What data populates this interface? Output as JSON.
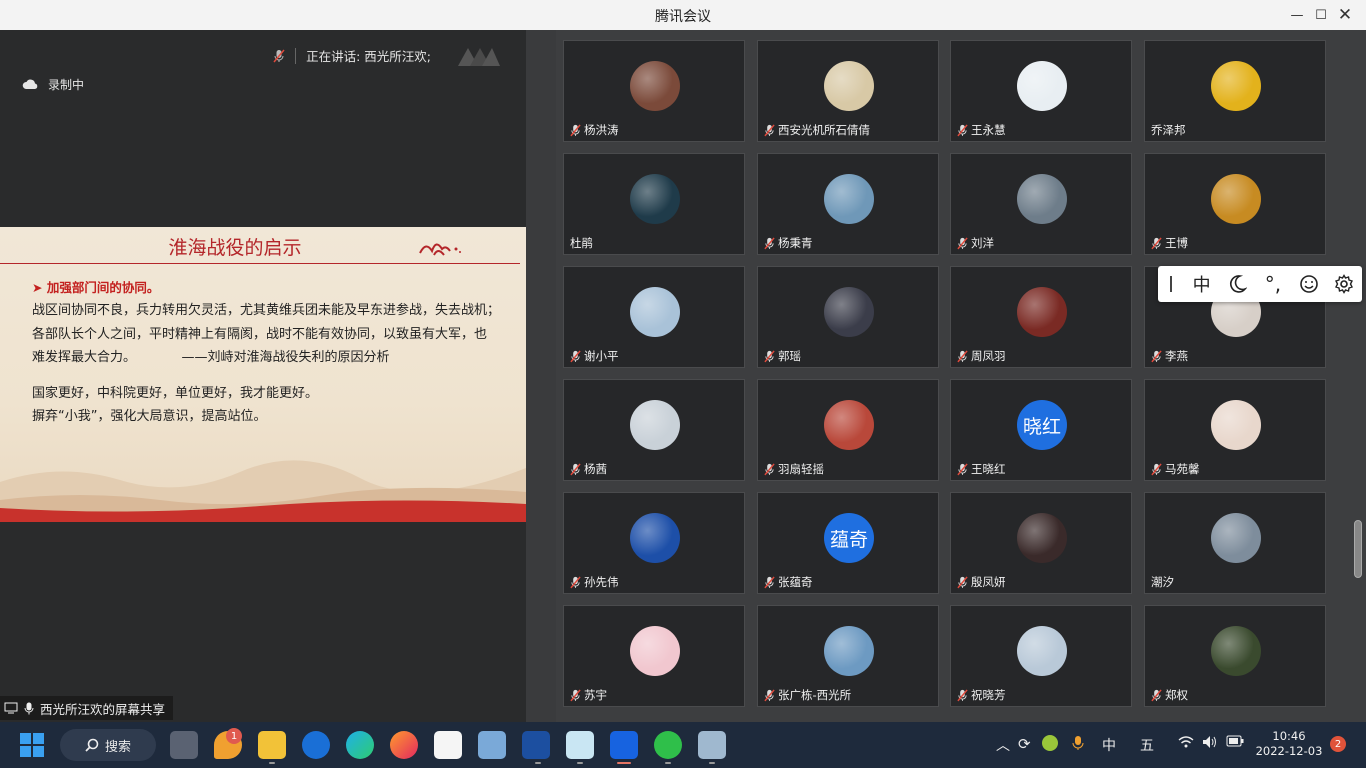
{
  "window": {
    "title": "腾讯会议"
  },
  "meeting": {
    "speaking": "正在讲话: 西光所汪欢;",
    "recording": "录制中",
    "share_label": "西光所汪欢的屏幕共享"
  },
  "slide": {
    "title": "淮海战役的启示",
    "subtitle": "➤ 加强部门间的协同。",
    "lines": [
      "战区间协同不良，兵力转用欠灵活，尤其黄维兵团未能及早东进参战，失去战机；",
      "各部队长个人之间，平时精神上有隔阂，战时不能有效协同，以致虽有大军，也",
      "难发挥最大合力。　　　　——刘峙对淮海战役失利的原因分析"
    ],
    "lines2": [
      "国家更好，中科院更好，单位更好，我才能更好。",
      "摒弃“小我”，强化大局意识，提高站位。"
    ]
  },
  "participants": [
    {
      "name": "杨洪涛",
      "muted": true,
      "avatar_text": "",
      "color": "#7b4a3a"
    },
    {
      "name": "西安光机所石倩倩",
      "muted": true,
      "avatar_text": "",
      "color": "#d8c9a6"
    },
    {
      "name": "王永慧",
      "muted": true,
      "avatar_text": "",
      "color": "#e8eef2"
    },
    {
      "name": "乔泽邦",
      "muted": false,
      "avatar_text": "",
      "color": "#e3b21c"
    },
    {
      "name": "杜鹃",
      "muted": false,
      "avatar_text": "",
      "color": "#1f3b4a"
    },
    {
      "name": "杨秉青",
      "muted": true,
      "avatar_text": "",
      "color": "#6f98b8"
    },
    {
      "name": "刘洋",
      "muted": true,
      "avatar_text": "",
      "color": "#6e7d8a"
    },
    {
      "name": "王博",
      "muted": true,
      "avatar_text": "",
      "color": "#c78b22"
    },
    {
      "name": "谢小平",
      "muted": true,
      "avatar_text": "",
      "color": "#a9c2d8"
    },
    {
      "name": "郭瑶",
      "muted": true,
      "avatar_text": "",
      "color": "#3b3d4a"
    },
    {
      "name": "周凤羽",
      "muted": true,
      "avatar_text": "",
      "color": "#7a2a24"
    },
    {
      "name": "李燕",
      "muted": true,
      "avatar_text": "",
      "color": "#d7cfc8"
    },
    {
      "name": "杨茜",
      "muted": true,
      "avatar_text": "",
      "color": "#c9d1d8"
    },
    {
      "name": "羽扇轻摇",
      "muted": true,
      "avatar_text": "",
      "color": "#b9483a"
    },
    {
      "name": "王晓红",
      "muted": true,
      "avatar_text": "晓红",
      "color": "#1f6fe0"
    },
    {
      "name": "马苑馨",
      "muted": true,
      "avatar_text": "",
      "color": "#e8d7cc"
    },
    {
      "name": "孙先伟",
      "muted": true,
      "avatar_text": "",
      "color": "#1d4fa8"
    },
    {
      "name": "张蕴奇",
      "muted": true,
      "avatar_text": "蕴奇",
      "color": "#1f6fe0"
    },
    {
      "name": "殷凤妍",
      "muted": true,
      "avatar_text": "",
      "color": "#3a2a2a"
    },
    {
      "name": "潮汐",
      "muted": false,
      "avatar_text": "",
      "color": "#7e8d9c"
    },
    {
      "name": "苏宇",
      "muted": true,
      "avatar_text": "",
      "color": "#f1c7cf"
    },
    {
      "name": "张广栋-西光所",
      "muted": true,
      "avatar_text": "",
      "color": "#6d9ac2"
    },
    {
      "name": "祝晓芳",
      "muted": true,
      "avatar_text": "",
      "color": "#b9c9d8"
    },
    {
      "name": "郑权",
      "muted": true,
      "avatar_text": "",
      "color": "#3a4a2e"
    }
  ],
  "ime": {
    "mode": "中"
  },
  "taskbar": {
    "search_label": "搜索",
    "badge": "1",
    "tray_lang": "中",
    "tray_input": "五",
    "time": "10:46",
    "date": "2022-12-03",
    "notifications": "2"
  }
}
